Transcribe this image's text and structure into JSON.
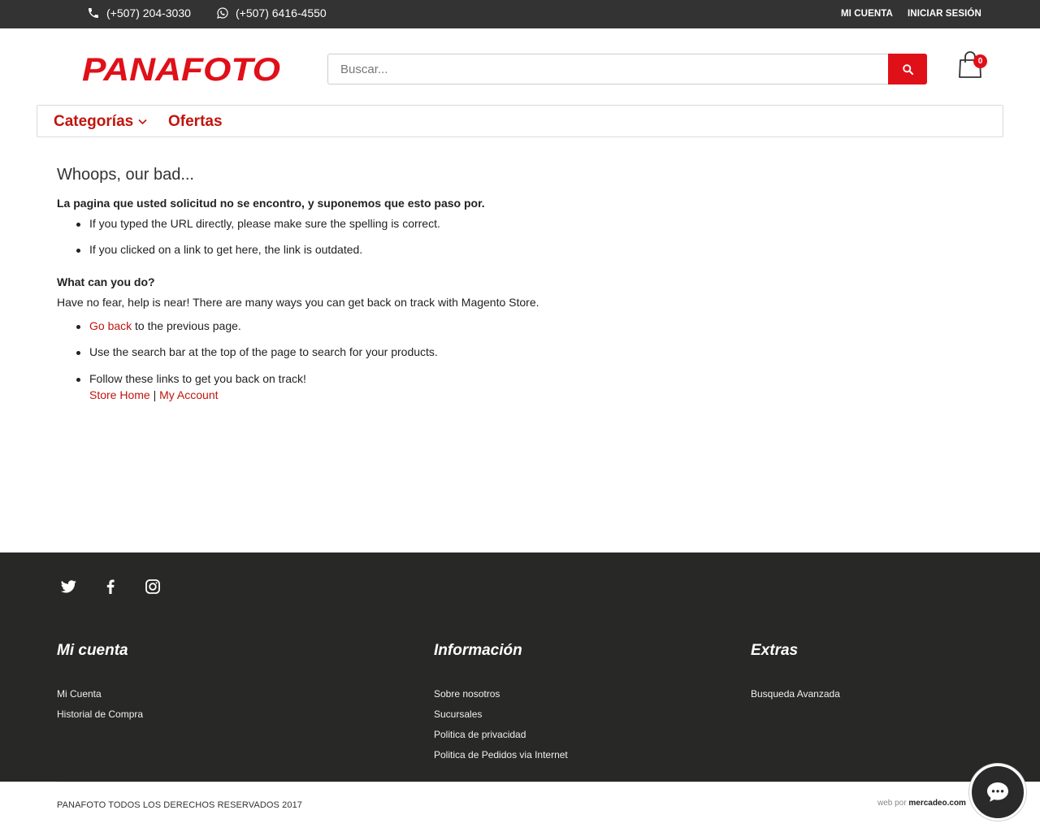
{
  "topbar": {
    "phone_label": "(+507) 204-3030",
    "whatsapp_label": "(+507) 6416-4550",
    "my_account_label": "MI CUENTA",
    "login_label": "INICIAR SESIÓN"
  },
  "header": {
    "logo_text": "PANAFOTO",
    "search_placeholder": "Buscar...",
    "cart_count": "0"
  },
  "nav": {
    "categories_label": "Categorías",
    "offers_label": "Ofertas"
  },
  "main": {
    "title": "Whoops, our bad...",
    "intro": "La pagina que usted solicitud no se encontro, y suponemos que esto paso por.",
    "reasons": [
      "If you typed the URL directly, please make sure the spelling is correct.",
      "If you clicked on a link to get here, the link is outdated."
    ],
    "what_heading": "What can you do?",
    "what_text": "Have no fear, help is near! There are many ways you can get back on track with Magento Store.",
    "go_back_link": "Go back",
    "go_back_rest": " to the previous page.",
    "search_tip": "Use the search bar at the top of the page to search for your products.",
    "follow_text": "Follow these links to get you back on track!",
    "store_home_link": "Store Home",
    "separator": " | ",
    "my_account_link": "My Account"
  },
  "footer": {
    "columns": [
      {
        "heading": "Mi cuenta",
        "links": [
          "Mi Cuenta",
          "Historial de Compra"
        ]
      },
      {
        "heading": "Información",
        "links": [
          "Sobre nosotros",
          "Sucursales",
          "Politica de privacidad",
          "Politica de Pedidos via Internet"
        ]
      },
      {
        "heading": "Extras",
        "links": [
          "Busqueda Avanzada"
        ]
      }
    ],
    "copyright": "PANAFOTO TODOS LOS DERECHOS RESERVADOS 2017",
    "web_by": "web por",
    "web_by_brand": "mercadeo.com"
  },
  "colors": {
    "brand_red": "#e01019",
    "link_red": "#c0150e",
    "dark": "#333333",
    "footer_bg": "#282826"
  },
  "icons": [
    "phone-icon",
    "whatsapp-icon",
    "search-icon",
    "cart-icon",
    "chevron-down-icon",
    "twitter-icon",
    "facebook-icon",
    "instagram-icon",
    "chat-icon"
  ]
}
